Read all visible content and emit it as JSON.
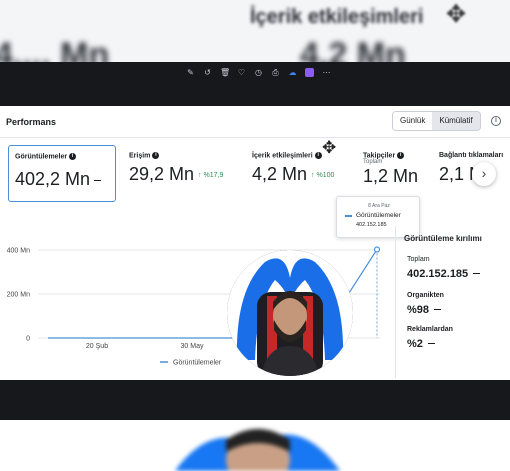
{
  "background_top": {
    "title": "İçerik etkileşimleri",
    "left_value": "4.... Mn",
    "right_value": "4,2 Mn"
  },
  "toolbar": {
    "icons": [
      "edit-icon",
      "undo-icon",
      "trash-icon",
      "heart-icon",
      "timer-icon",
      "printer-icon",
      "cloud-icon",
      "app-icon",
      "more-icon"
    ]
  },
  "panel": {
    "title": "Performans",
    "view_options": [
      "Günlük",
      "Kümülatif"
    ],
    "selected_view": "Kümülatif",
    "info": "i"
  },
  "metrics": [
    {
      "label": "Görüntülemeler",
      "value": "402,2 Mn",
      "delta": "",
      "sub": "",
      "selected": true
    },
    {
      "label": "Erişim",
      "value": "29,2 Mn",
      "delta": "↑ %17,9",
      "sub": ""
    },
    {
      "label": "İçerik etkileşimleri",
      "value": "4,2 Mn",
      "delta": "↑ %100",
      "sub": ""
    },
    {
      "label": "Takipçiler",
      "value": "1,2 Mn",
      "delta": "",
      "sub": "Toplam"
    },
    {
      "label": "Bağlantı tıklamaları",
      "value": "2,1 M",
      "delta": "",
      "sub": ""
    }
  ],
  "next_button": "›",
  "chart_data": {
    "type": "line",
    "y_tick_labels": [
      "400 Mn",
      "200 Mn",
      "0"
    ],
    "y_ticks": [
      400,
      200,
      0
    ],
    "x_tick_labels": [
      "20 Şub",
      "30 May"
    ],
    "ylim": [
      0,
      400
    ],
    "series": [
      {
        "name": "Görüntülemeler",
        "x": [
          "20 Şub",
          "30 May",
          "8 Ara"
        ],
        "values": [
          0,
          0,
          402.152185
        ]
      }
    ],
    "legend": "bottom",
    "grid": true,
    "color": "#4a90d9"
  },
  "tooltip": {
    "date": "8 Ara Paz",
    "series_name": "Görüntülemeler",
    "value": "402.152.185"
  },
  "breakdown": {
    "title": "Görüntüleme kırılımı",
    "total_label": "Toplam",
    "total_value": "402.152.185",
    "organic_label": "Organikten",
    "organic_value": "%98",
    "ads_label": "Reklamlardan",
    "ads_value": "%2"
  }
}
